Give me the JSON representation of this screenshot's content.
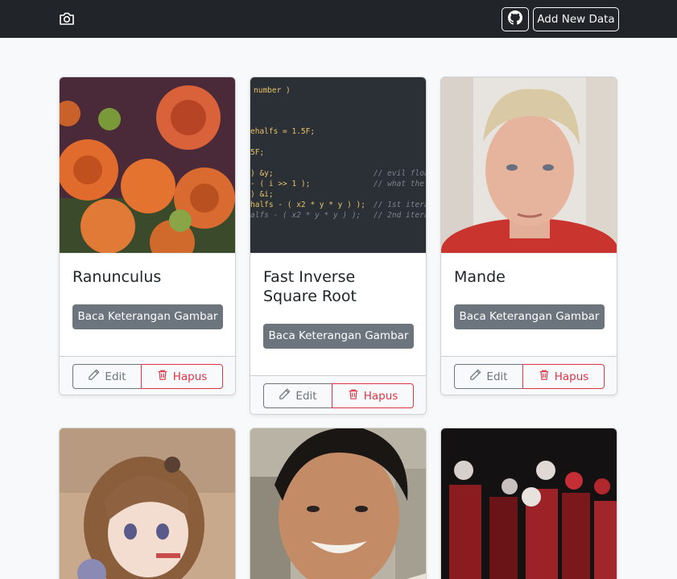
{
  "navbar": {
    "brand_icon": "camera-icon",
    "github_icon": "github-icon",
    "add_label": "Add New Data",
    "bg": "#212529"
  },
  "cards": [
    {
      "title": "Ranunculus",
      "image": "orange-ranunculus-flowers",
      "read_label": "Baca Keterangan Gambar",
      "edit_label": "Edit",
      "delete_label": "Hapus"
    },
    {
      "title": "Fast Inverse Square Root",
      "image": "code-editor-screenshot",
      "read_label": "Baca Keterangan Gambar",
      "edit_label": "Edit",
      "delete_label": "Hapus",
      "code_lines": [
        "number )",
        "",
        "",
        "ehalfs = 1.5F;",
        "",
        "5F;",
        "",
        ") &y;",
        "- ( i >> 1 );",
        ") &i;",
        "halfs - ( x2 * y * y ) );",
        "alfs - ( x2 * y * y ) );"
      ],
      "code_comments": [
        "// evil floa",
        "// what the",
        "",
        "// 1st itera",
        "// 2nd itera"
      ]
    },
    {
      "title": "Mande",
      "image": "selfie-blond-man",
      "read_label": "Baca Keterangan Gambar",
      "edit_label": "Edit",
      "delete_label": "Hapus"
    },
    {
      "title": "",
      "image": "anime-girl-illustration"
    },
    {
      "title": "",
      "image": "smiling-man-photo"
    },
    {
      "title": "",
      "image": "masked-band-photo"
    }
  ],
  "colors": {
    "secondary": "#6c757d",
    "danger": "#dc3545",
    "page_bg": "#f8f9fa"
  }
}
